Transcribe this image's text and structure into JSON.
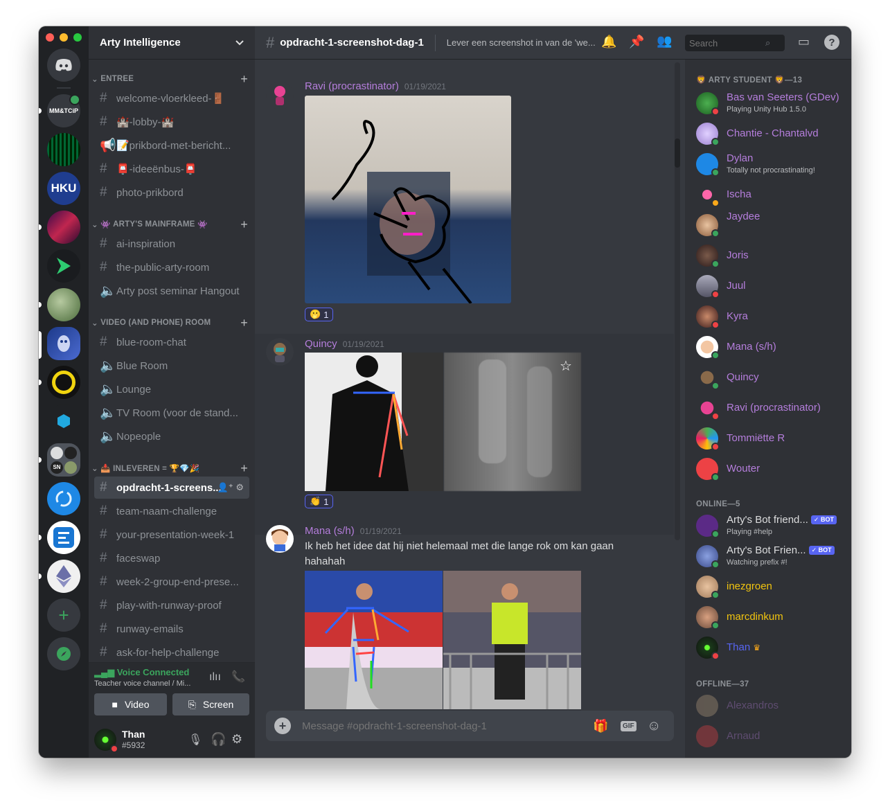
{
  "server": {
    "name": "Arty Intelligence",
    "mm_label": "MM&TCiP",
    "hku_label": "HKU",
    "sn_label": "SN"
  },
  "categories": {
    "entree": "ENTREE",
    "mainframe": "ARTY'S MAINFRAME",
    "video_room": "VIDEO (AND PHONE) ROOM",
    "inleveren": "INLEVEREN = 🏆💎🎉"
  },
  "channels": [
    {
      "label": "welcome-vloerkleed-🚪"
    },
    {
      "label": "🏰-lobby-🏰"
    },
    {
      "label": "📝prikbord-met-bericht..."
    },
    {
      "label": "📮-ideeënbus-📮"
    },
    {
      "label": "photo-prikbord"
    },
    {
      "label": "ai-inspiration"
    },
    {
      "label": "the-public-arty-room"
    },
    {
      "label": "Arty post seminar Hangout"
    },
    {
      "label": "blue-room-chat"
    },
    {
      "label": "Blue Room"
    },
    {
      "label": "Lounge"
    },
    {
      "label": "TV Room (voor de stand..."
    },
    {
      "label": "Nopeople"
    },
    {
      "label": "opdracht-1-screens..."
    },
    {
      "label": "team-naam-challenge"
    },
    {
      "label": "your-presentation-week-1"
    },
    {
      "label": "faceswap"
    },
    {
      "label": "week-2-group-end-prese..."
    },
    {
      "label": "play-with-runway-proof"
    },
    {
      "label": "runway-emails"
    },
    {
      "label": "ask-for-help-challenge"
    }
  ],
  "voice": {
    "status": "Voice Connected",
    "channel": "Teacher voice channel / Mi...",
    "video_label": "Video",
    "screen_label": "Screen"
  },
  "user": {
    "name": "Than",
    "tag": "#5932"
  },
  "channel_header": {
    "name": "opdracht-1-screenshot-dag-1",
    "topic": "Lever een screenshot in van de 'we...",
    "search_placeholder": "Search"
  },
  "messages": [
    {
      "author": "Ravi (procrastinator)",
      "date": "01/19/2021",
      "reaction_count": "1"
    },
    {
      "author": "Quincy",
      "date": "01/19/2021",
      "reaction_count": "1"
    },
    {
      "author": "Mana (s/h)",
      "date": "01/19/2021",
      "text": "Ik heb het idee dat hij niet helemaal met die lange rok om kan gaan hahahah"
    }
  ],
  "composer": {
    "placeholder": "Message #opdracht-1-screenshot-dag-1",
    "gif_label": "GIF"
  },
  "member_groups": {
    "arty_student": "ARTY STUDENT 🦁—13",
    "online": "ONLINE—5",
    "offline": "OFFLINE—37"
  },
  "members": [
    {
      "name": "Bas van Seeters (GDev)",
      "sub": "Playing Unity Hub 1.5.0"
    },
    {
      "name": "Chantie - Chantalvd"
    },
    {
      "name": "Dylan",
      "sub": "Totally not procrastinating!"
    },
    {
      "name": "Ischa"
    },
    {
      "name": "Jaydee"
    },
    {
      "name": "Joris"
    },
    {
      "name": "Juul"
    },
    {
      "name": "Kyra"
    },
    {
      "name": "Mana (s/h)"
    },
    {
      "name": "Quincy"
    },
    {
      "name": "Ravi (procrastinator)"
    },
    {
      "name": "Tommiëtte R"
    },
    {
      "name": "Wouter"
    },
    {
      "name": "Arty's Bot friend...",
      "sub": "Playing #help",
      "badge": "✓ BOT"
    },
    {
      "name": "Arty's Bot Frien...",
      "sub": "Watching prefix #!",
      "badge": "✓ BOT"
    },
    {
      "name": "inezgroen"
    },
    {
      "name": "marcdinkum"
    },
    {
      "name": "Than"
    },
    {
      "name": "Alexandros"
    },
    {
      "name": "Arnaud"
    }
  ],
  "colors": {
    "student_role": "#b57edc",
    "online_role": "#f1c40f",
    "blurple": "#5865f2",
    "online": "#3ba55d",
    "dnd": "#ed4245",
    "idle": "#faa81a"
  }
}
